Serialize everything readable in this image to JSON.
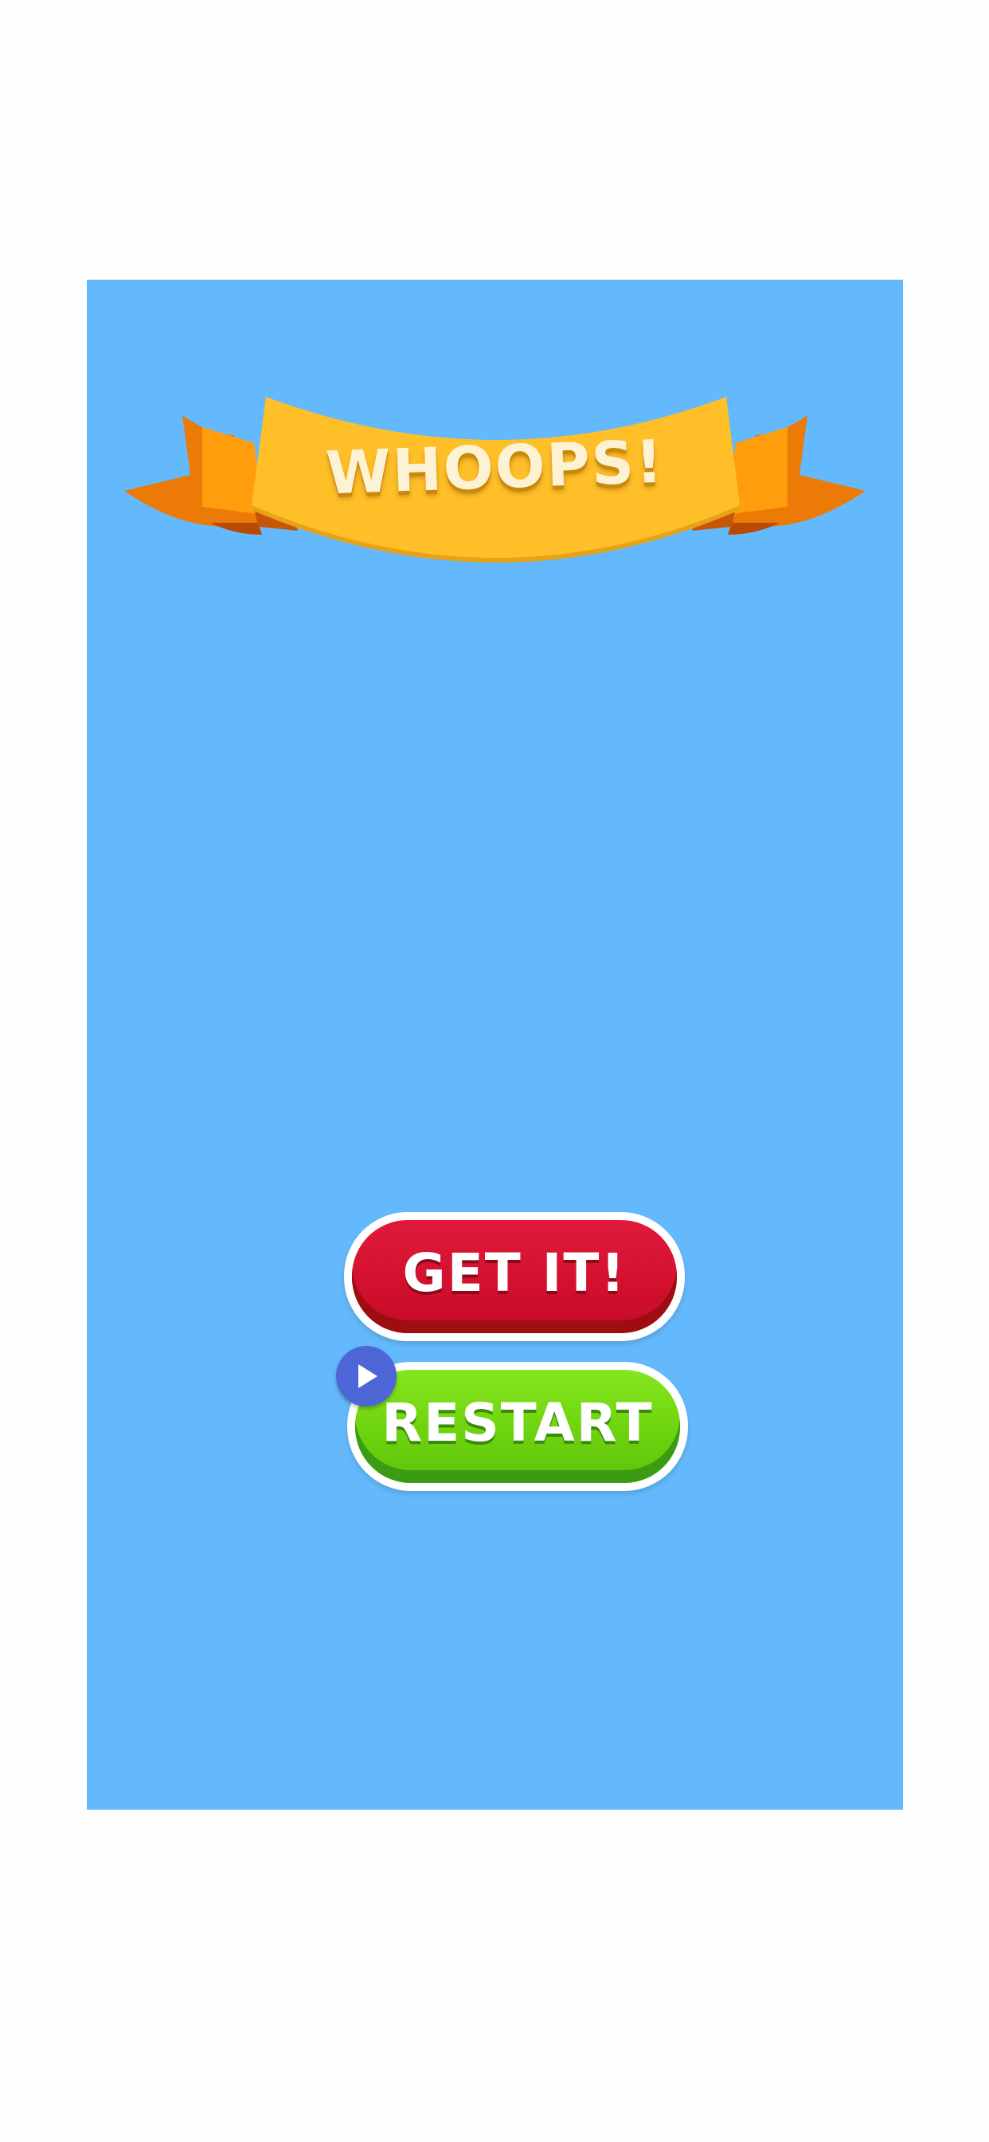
{
  "banner": {
    "title": "WHOOPS!"
  },
  "buttons": {
    "get_it_label": "GET IT!",
    "restart_label": "RESTART"
  },
  "ad_badge": {
    "icon": "play-icon"
  },
  "colors": {
    "background": "#63b9fb",
    "banner_main": "#ffbf28",
    "banner_tail": "#f07a07",
    "get_it": "#d3112f",
    "restart": "#6dd30e",
    "ad_badge": "#4d66d6"
  }
}
